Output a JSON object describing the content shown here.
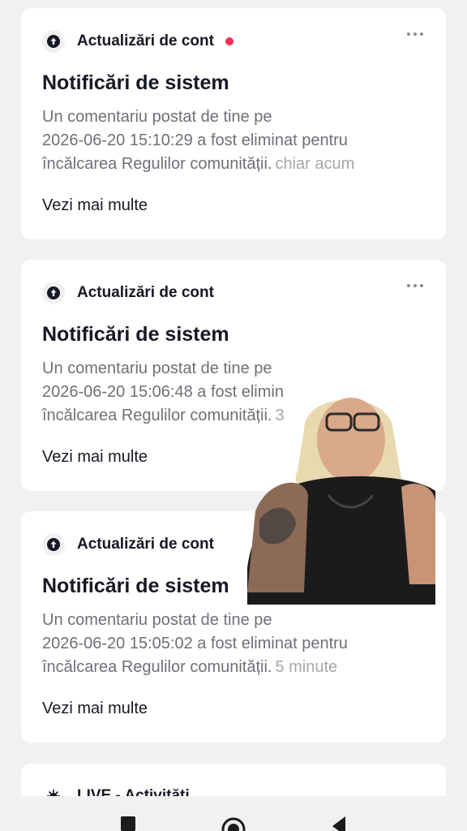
{
  "cards": [
    {
      "category": "Actualizări de cont",
      "unread": true,
      "title": "Notificări de sistem",
      "body_line1": "Un comentariu postat de tine pe",
      "body_line2": "2026-06-20 15:10:29 a fost eliminat pentru",
      "body_line3": "încălcarea Regulilor comunității.",
      "time": "chiar acum",
      "see_more": "Vezi mai multe",
      "icon": "arrow-up-circle-icon"
    },
    {
      "category": "Actualizări de cont",
      "unread": false,
      "title": "Notificări de sistem",
      "body_line1": "Un comentariu postat de tine pe",
      "body_line2": "2026-06-20 15:06:48 a fost elimin",
      "body_line3": "încălcarea Regulilor comunității.",
      "time": "3",
      "see_more": "Vezi mai multe",
      "icon": "arrow-up-circle-icon"
    },
    {
      "category": "Actualizări de cont",
      "unread": false,
      "title": "Notificări de sistem",
      "body_line1": "Un comentariu postat de tine pe",
      "body_line2": "2026-06-20 15:05:02 a fost eliminat pentru",
      "body_line3": "încălcarea Regulilor comunității.",
      "time": "5 minute",
      "see_more": "Vezi mai multe",
      "icon": "arrow-up-circle-icon"
    }
  ],
  "partial_card": {
    "category": "LIVE - Activități",
    "icon": "live-icon"
  },
  "navbar": {
    "recents_icon": "square-icon",
    "home_icon": "circle-home-icon",
    "back_icon": "triangle-back-icon"
  },
  "colors": {
    "accent_dot": "#fe2c55",
    "title_text": "#161823",
    "body_text": "#6f7077",
    "time_text": "#a6a7ab"
  }
}
